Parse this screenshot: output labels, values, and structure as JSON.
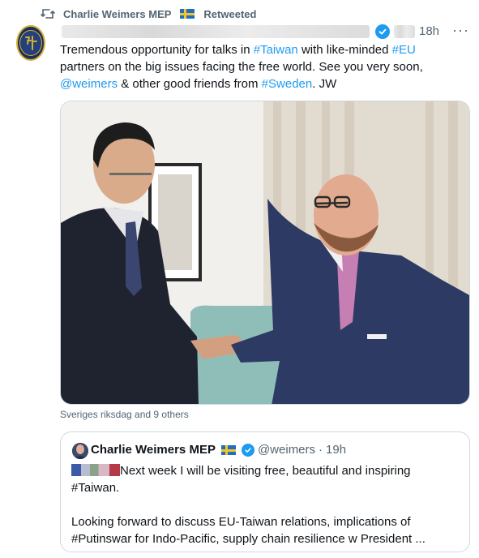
{
  "retweet": {
    "name": "Charlie Weimers MEP",
    "label": "Retweeted"
  },
  "tweet": {
    "time": "18h",
    "more": "···",
    "text": {
      "p1": "Tremendous opportunity for talks in ",
      "tag_taiwan": "#Taiwan",
      "p2": " with like-minded ",
      "tag_eu": "#EU",
      "p3": " partners on the big issues facing the free world. See you very soon, ",
      "mention": "@weimers",
      "p4": " & other good friends from ",
      "tag_sweden": "#Sweden",
      "p5": ". JW"
    },
    "tagged": "Sveriges riksdag and 9 others"
  },
  "quote": {
    "name": "Charlie Weimers MEP",
    "handle": "@weimers",
    "dot": "·",
    "time": "19h",
    "line1": "Next week I will be visiting free, beautiful and inspiring",
    "line2": "#Taiwan.",
    "line3": "Looking forward to discuss EU-Taiwan relations, implications of",
    "line4": "#Putinswar for Indo-Pacific, supply chain resilience w President ..."
  },
  "colors": {
    "accent": "#1d9bf0",
    "secondary_text": "#536471",
    "border": "#cfd9de"
  },
  "icons": {
    "retweet": "retweet-icon",
    "verified": "verified-badge-icon",
    "more": "more-options-icon",
    "flag": "sweden-flag-icon"
  }
}
